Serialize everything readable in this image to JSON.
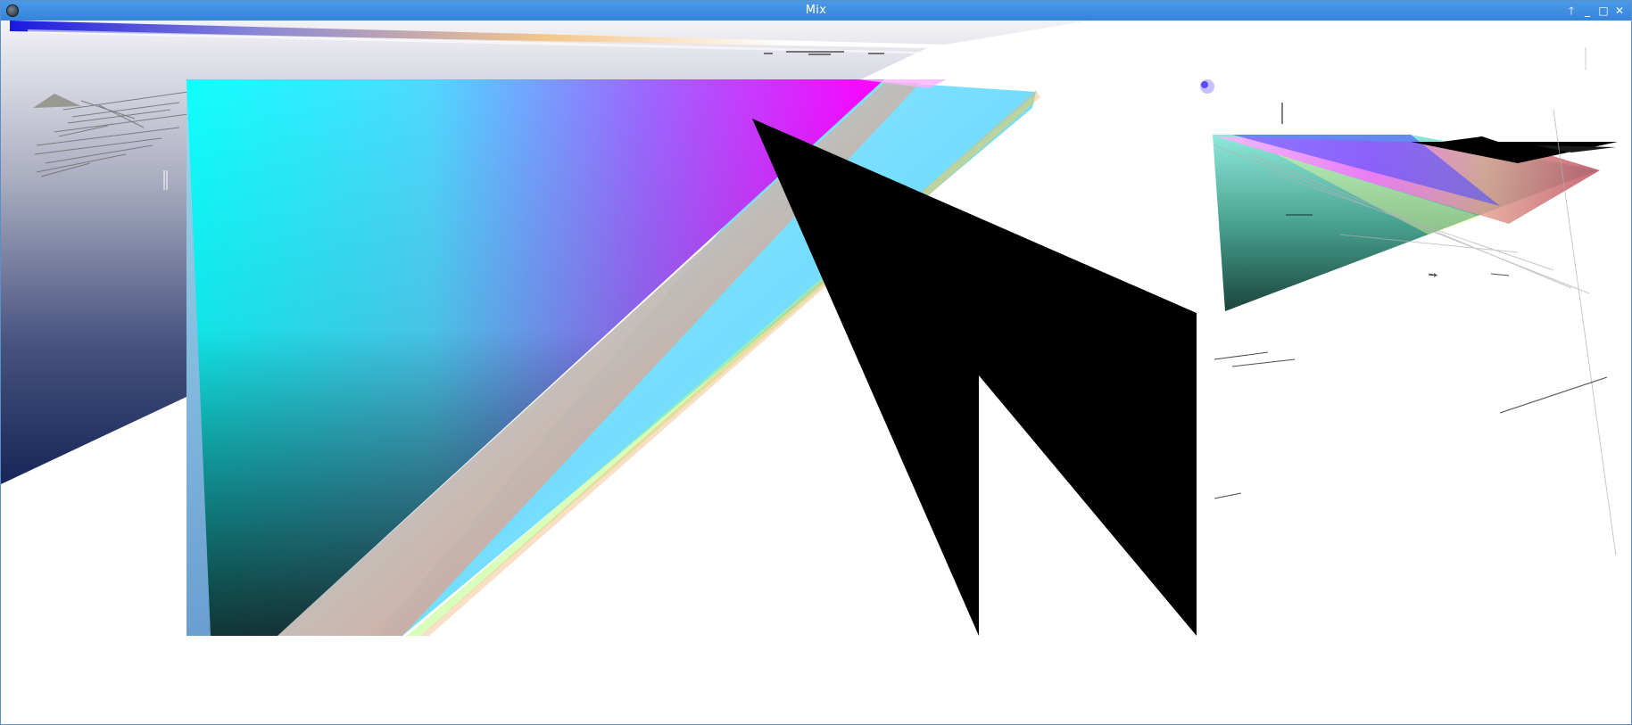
{
  "window": {
    "title": "Mix",
    "icons": {
      "app": "app-icon",
      "shade": "shade-up-icon",
      "minimize": "minimize-icon",
      "maximize": "maximize-icon",
      "close": "close-icon"
    },
    "controls": {
      "shade_glyph": "🡑",
      "minimize_glyph": "_",
      "maximize_glyph": "□",
      "close_glyph": "✕"
    }
  },
  "colors": {
    "titlebar": "#3584db",
    "cyan": "#00ffff",
    "magenta": "#ff00ff",
    "navy": "#0a1a4f",
    "black": "#000000"
  }
}
